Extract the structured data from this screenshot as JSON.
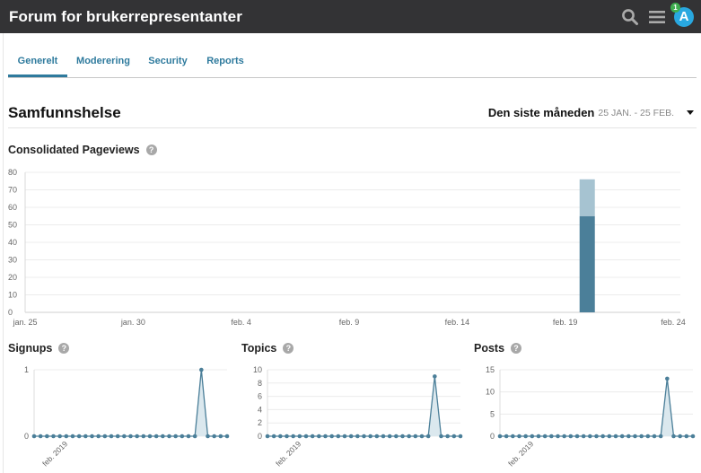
{
  "header": {
    "site_title": "Forum for brukerrepresentanter",
    "search_icon": "search-icon",
    "menu_icon": "hamburger-menu-icon",
    "avatar_letter": "A",
    "notification_count": "1"
  },
  "tabs": [
    {
      "label": "Generelt",
      "active": true
    },
    {
      "label": "Moderering",
      "active": false
    },
    {
      "label": "Security",
      "active": false
    },
    {
      "label": "Reports",
      "active": false
    }
  ],
  "section": {
    "title": "Samfunnshelse",
    "period_label": "Den siste måneden",
    "period_range": "25 JAN. - 25 FEB."
  },
  "colors": {
    "accent": "#2e7a9d",
    "bar_dark": "#4b7f99",
    "bar_light": "#a6c3d1",
    "line": "#4b7f99"
  },
  "chart_data": [
    {
      "type": "bar",
      "title": "Consolidated Pageviews",
      "ylim": [
        0,
        80
      ],
      "yticks": [
        0,
        10,
        20,
        30,
        40,
        50,
        60,
        70,
        80
      ],
      "xtick_labels": [
        "jan. 25",
        "jan. 30",
        "feb. 4",
        "feb. 9",
        "feb. 14",
        "feb. 19",
        "feb. 24"
      ],
      "xtick_index": [
        0,
        5,
        10,
        15,
        20,
        25,
        30
      ],
      "n_days": 31,
      "stacked": true,
      "series": [
        {
          "values": [
            0,
            0,
            0,
            0,
            0,
            0,
            0,
            0,
            0,
            0,
            0,
            0,
            0,
            0,
            0,
            0,
            0,
            0,
            0,
            0,
            0,
            0,
            0,
            0,
            0,
            0,
            55,
            0,
            0,
            0,
            0
          ],
          "color": "#4b7f99"
        },
        {
          "values": [
            0,
            0,
            0,
            0,
            0,
            0,
            0,
            0,
            0,
            0,
            0,
            0,
            0,
            0,
            0,
            0,
            0,
            0,
            0,
            0,
            0,
            0,
            0,
            0,
            0,
            0,
            21,
            0,
            0,
            0,
            0
          ],
          "color": "#a6c3d1"
        }
      ],
      "grid": true
    },
    {
      "type": "line",
      "title": "Signups",
      "ylim": [
        0,
        1
      ],
      "yticks": [
        0,
        1
      ],
      "xtick_label": "feb. 2019",
      "values": [
        0,
        0,
        0,
        0,
        0,
        0,
        0,
        0,
        0,
        0,
        0,
        0,
        0,
        0,
        0,
        0,
        0,
        0,
        0,
        0,
        0,
        0,
        0,
        0,
        0,
        0,
        1,
        0,
        0,
        0,
        0
      ]
    },
    {
      "type": "line",
      "title": "Topics",
      "ylim": [
        0,
        10
      ],
      "yticks": [
        0,
        2,
        4,
        6,
        8,
        10
      ],
      "xtick_label": "feb. 2019",
      "values": [
        0,
        0,
        0,
        0,
        0,
        0,
        0,
        0,
        0,
        0,
        0,
        0,
        0,
        0,
        0,
        0,
        0,
        0,
        0,
        0,
        0,
        0,
        0,
        0,
        0,
        0,
        9,
        0,
        0,
        0,
        0
      ]
    },
    {
      "type": "line",
      "title": "Posts",
      "ylim": [
        0,
        15
      ],
      "yticks": [
        0,
        5,
        10,
        15
      ],
      "xtick_label": "feb. 2019",
      "values": [
        0,
        0,
        0,
        0,
        0,
        0,
        0,
        0,
        0,
        0,
        0,
        0,
        0,
        0,
        0,
        0,
        0,
        0,
        0,
        0,
        0,
        0,
        0,
        0,
        0,
        0,
        13,
        0,
        0,
        0,
        0
      ]
    }
  ]
}
